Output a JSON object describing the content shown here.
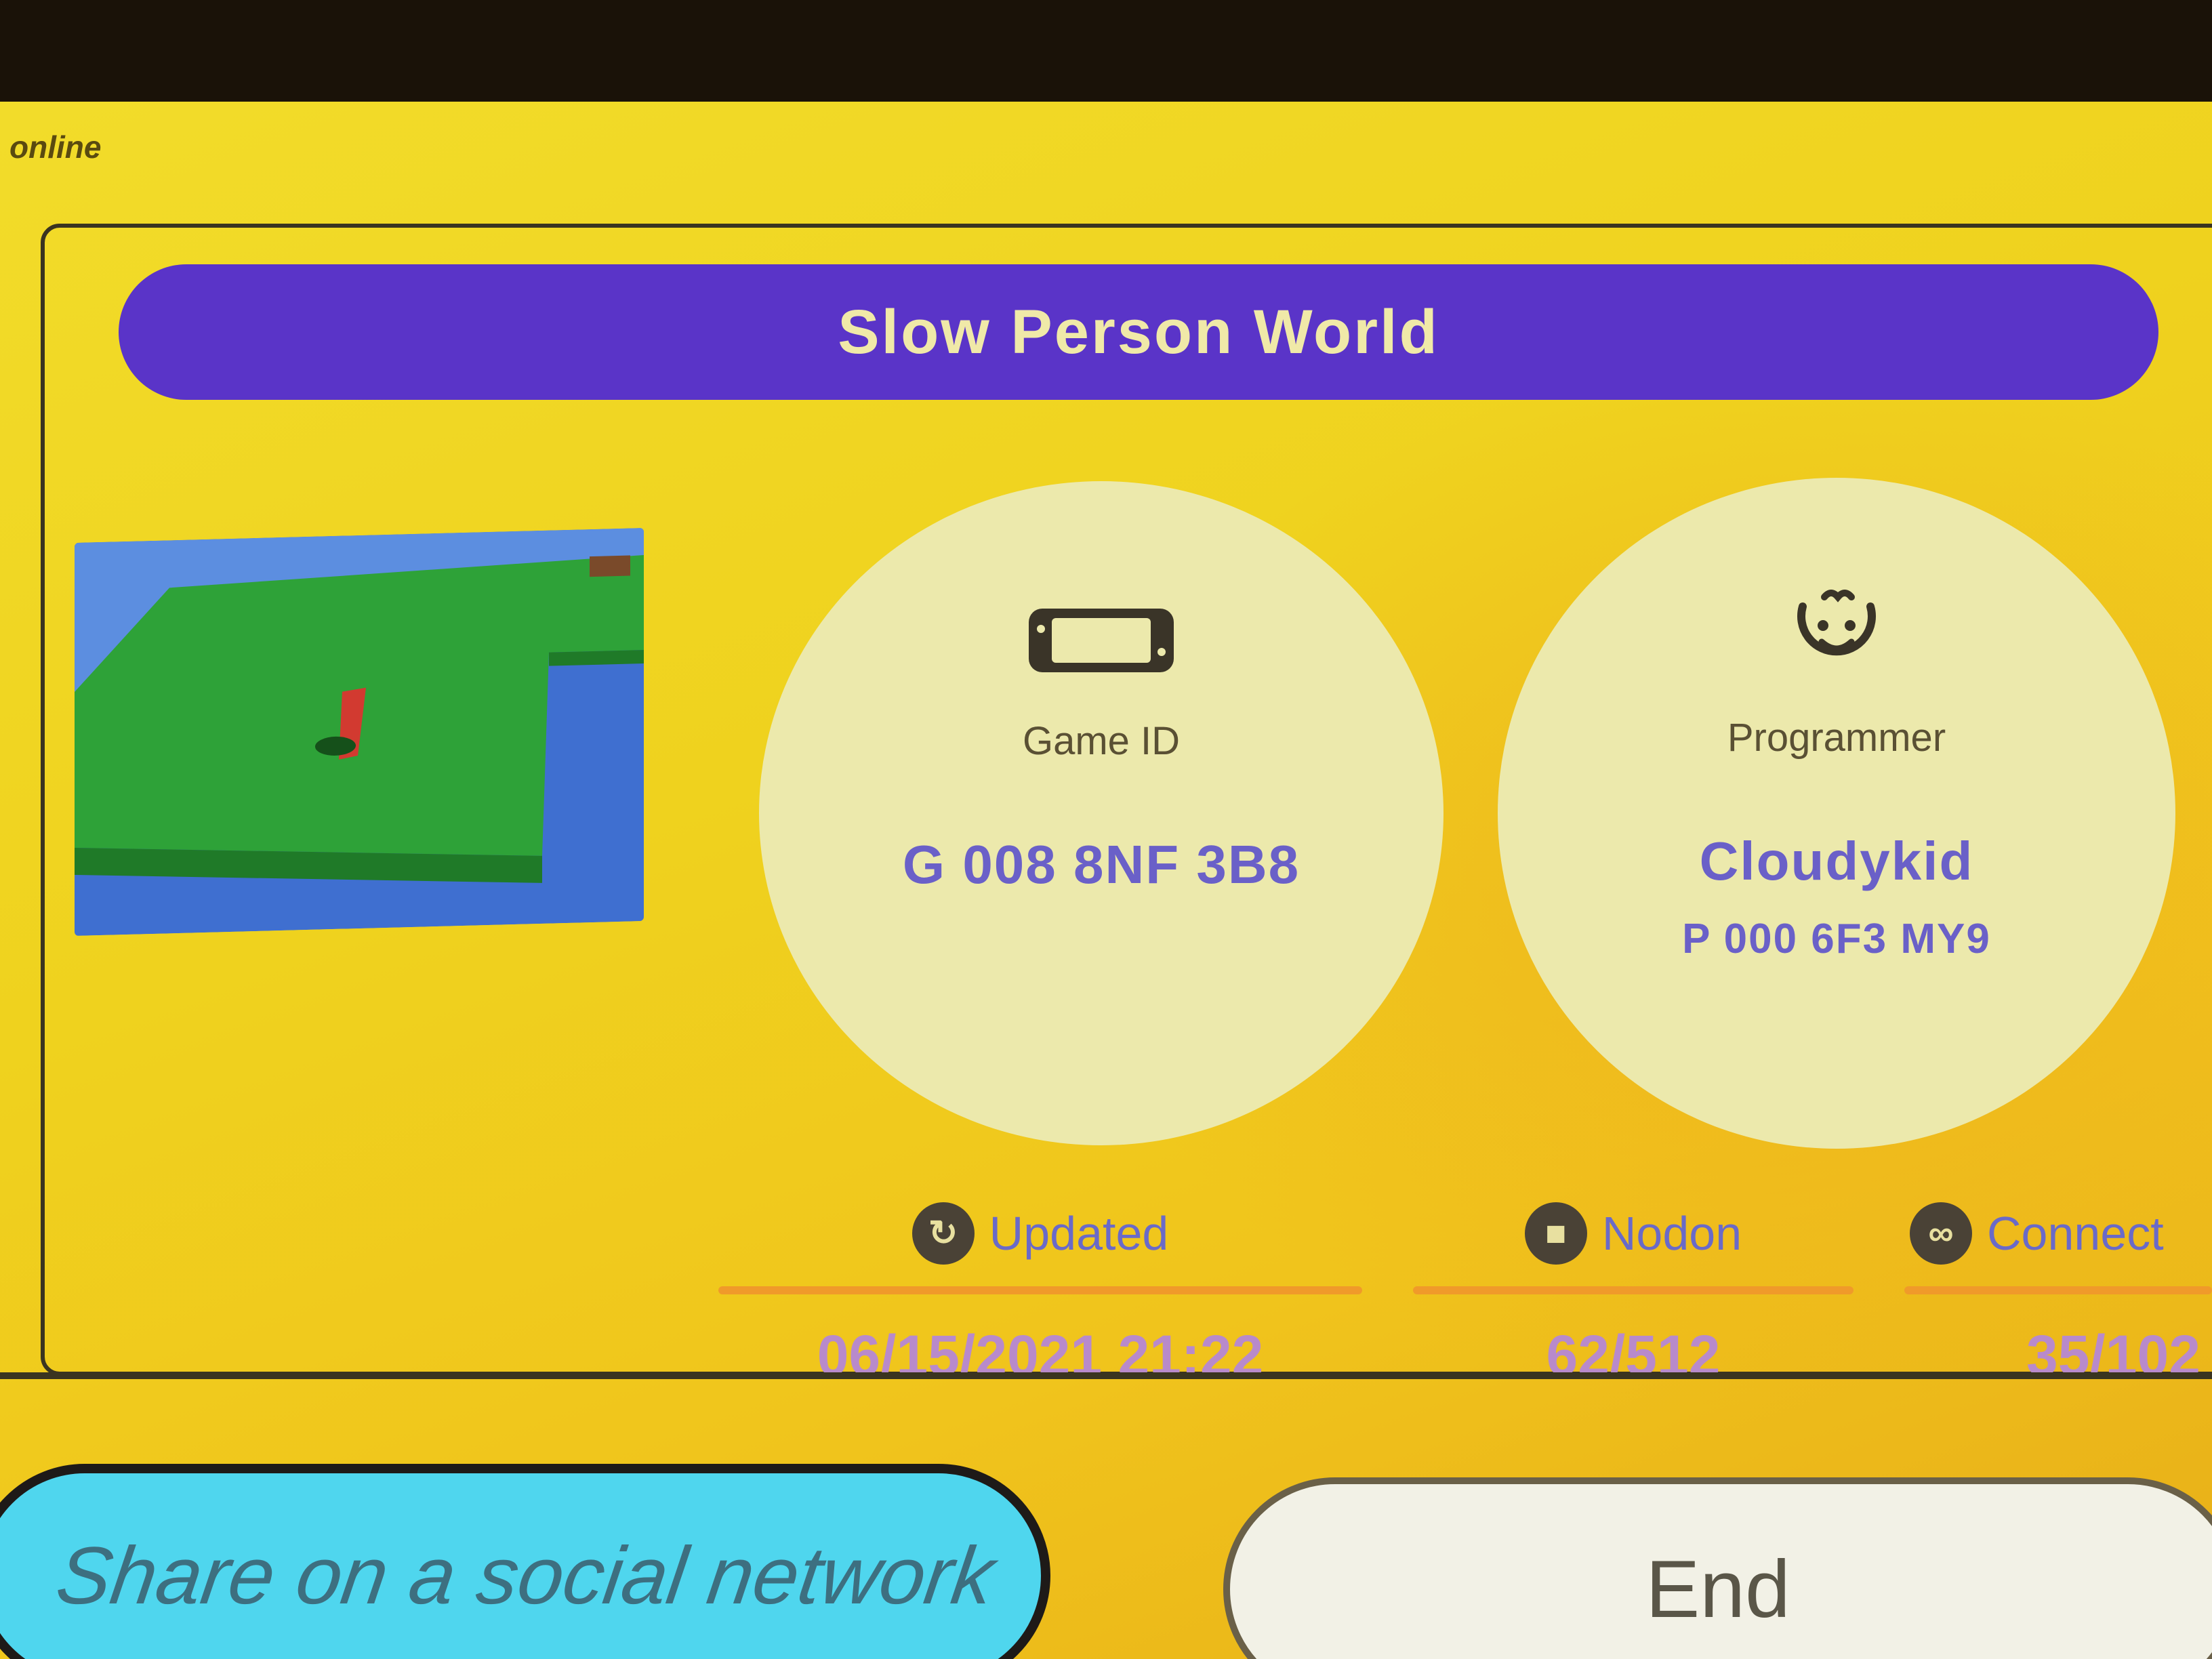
{
  "status": {
    "online_label": "online"
  },
  "game": {
    "title": "Slow Person World",
    "game_id_label": "Game ID",
    "game_id": "G 008 8NF 3B8",
    "programmer_label": "Programmer",
    "programmer_name": "Cloudykid",
    "programmer_id": "P 000 6F3 MY9"
  },
  "stats": {
    "updated_label": "Updated",
    "updated_value": "06/15/2021 21:22",
    "nodon_label": "Nodon",
    "nodon_value": "62/512",
    "connect_label": "Connect",
    "connect_value": "35/102"
  },
  "buttons": {
    "share_label": "Share on a social network",
    "end_label": "End"
  },
  "colors": {
    "background": "#f0d020",
    "title_bar": "#5a34c8",
    "circle": "#ece9ac",
    "value_text": "#6a60c8",
    "stat_line": "#f09a2a",
    "share_button": "#4fd6ee",
    "end_button": "#f2f1e6"
  },
  "icons": {
    "game_id": "console-icon",
    "programmer": "face-icon",
    "updated": "clock-icon",
    "nodon": "nodon-icon",
    "connect": "connect-icon"
  }
}
